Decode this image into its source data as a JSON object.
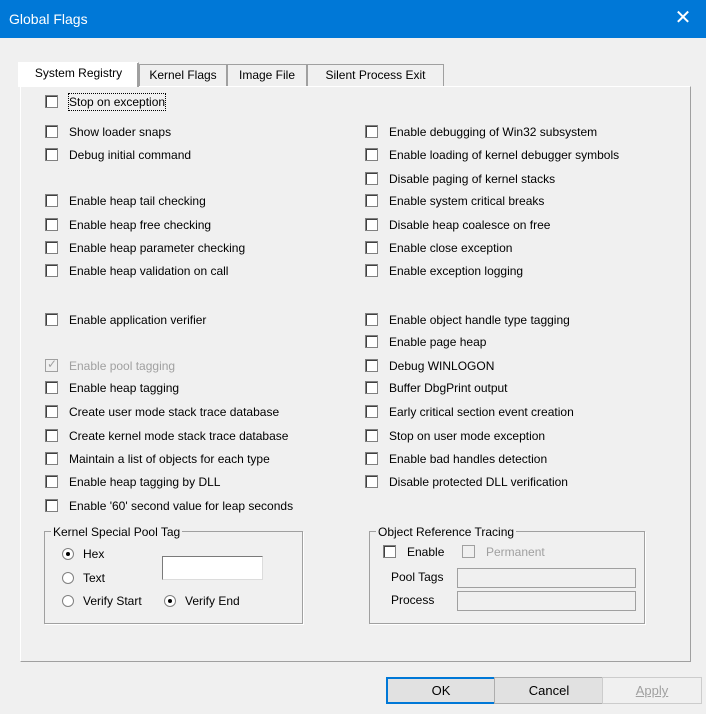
{
  "window": {
    "title": "Global Flags",
    "close_glyph": "✕"
  },
  "tabs": [
    {
      "label": "System Registry",
      "active": true
    },
    {
      "label": "Kernel Flags",
      "active": false
    },
    {
      "label": "Image File",
      "active": false
    },
    {
      "label": "Silent Process Exit",
      "active": false
    }
  ],
  "left_flags": {
    "stop_on_exception": "Stop on exception",
    "show_loader_snaps": "Show loader snaps",
    "debug_initial_command": "Debug initial command",
    "heap_tail": "Enable heap tail checking",
    "heap_free": "Enable heap free checking",
    "heap_param": "Enable heap parameter checking",
    "heap_validation": "Enable heap validation on call",
    "app_verifier": "Enable application verifier",
    "pool_tagging": "Enable pool tagging",
    "heap_tagging": "Enable heap tagging",
    "user_stack_trace": "Create user mode stack trace database",
    "kernel_stack_trace": "Create kernel mode stack trace database",
    "objects_list": "Maintain a list of objects for each type",
    "heap_tag_dll": "Enable heap tagging by DLL",
    "leap_seconds": "Enable '60' second value for leap seconds"
  },
  "right_flags": {
    "debug_win32": "Enable debugging of Win32 subsystem",
    "kernel_debugger_symbols": "Enable loading of kernel debugger symbols",
    "disable_paging": "Disable paging of kernel stacks",
    "system_critical": "Enable system critical breaks",
    "heap_coalesce": "Disable heap coalesce on free",
    "close_exception": "Enable close exception",
    "exception_logging": "Enable exception logging",
    "object_handle_tagging": "Enable object handle type tagging",
    "page_heap": "Enable page heap",
    "debug_winlogon": "Debug WINLOGON",
    "buffer_dbgprint": "Buffer DbgPrint output",
    "early_critical": "Early critical section event creation",
    "stop_user_exception": "Stop on user mode exception",
    "bad_handles": "Enable bad handles detection",
    "protected_dll": "Disable protected DLL verification"
  },
  "pool_tag_group": {
    "title": "Kernel Special Pool Tag",
    "hex": "Hex",
    "text": "Text",
    "verify_start": "Verify Start",
    "verify_end": "Verify End",
    "tag_value": ""
  },
  "object_tracing_group": {
    "title": "Object Reference Tracing",
    "enable": "Enable",
    "permanent": "Permanent",
    "pool_tags": "Pool Tags",
    "process": "Process",
    "pool_tags_value": "",
    "process_value": ""
  },
  "buttons": {
    "ok": "OK",
    "cancel": "Cancel",
    "apply": "Apply"
  }
}
